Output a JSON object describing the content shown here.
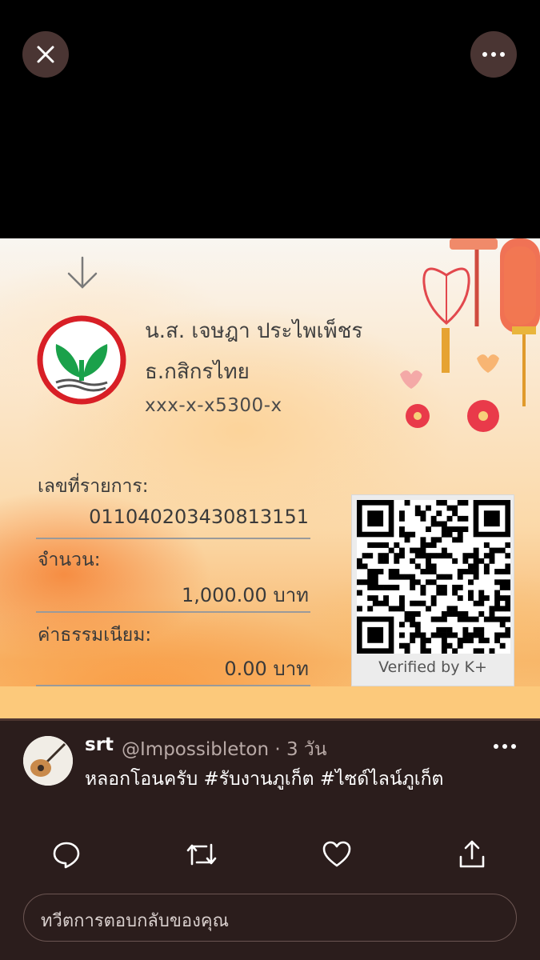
{
  "viewer": {
    "close_icon": "close-icon",
    "more_icon": "more-horizontal-icon"
  },
  "slip": {
    "logo_icon": "kbank-logo",
    "arrow_icon": "arrow-down-icon",
    "account_name": "น.ส. เจษฎา ประไพเพ็ชร",
    "bank_name": "ธ.กสิกรไทย",
    "account_number": "xxx-x-x5300-x",
    "ref_label": "เลขที่รายการ:",
    "ref_value": "011040203430813151",
    "amount_label": "จำนวน:",
    "amount_value": "1,000.00 บาท",
    "fee_label": "ค่าธรรมเนียม:",
    "fee_value": "0.00 บาท",
    "qr_caption": "Verified by K+",
    "colors": {
      "logo_red": "#d81f26",
      "logo_green": "#1aa14a"
    }
  },
  "tweet": {
    "display_name": "srt",
    "handle_time": "@Impossibleton · 3 วัน",
    "text": "หลอกโอนครับ #รับงานภูเก็ต #ไซด์ไลน์ภูเก็ต",
    "actions": [
      {
        "name": "reply",
        "icon": "reply-icon"
      },
      {
        "name": "retweet",
        "icon": "retweet-icon"
      },
      {
        "name": "like",
        "icon": "heart-icon"
      },
      {
        "name": "share",
        "icon": "share-icon"
      }
    ],
    "reply_placeholder": "ทวีตการตอบกลับของคุณ"
  }
}
